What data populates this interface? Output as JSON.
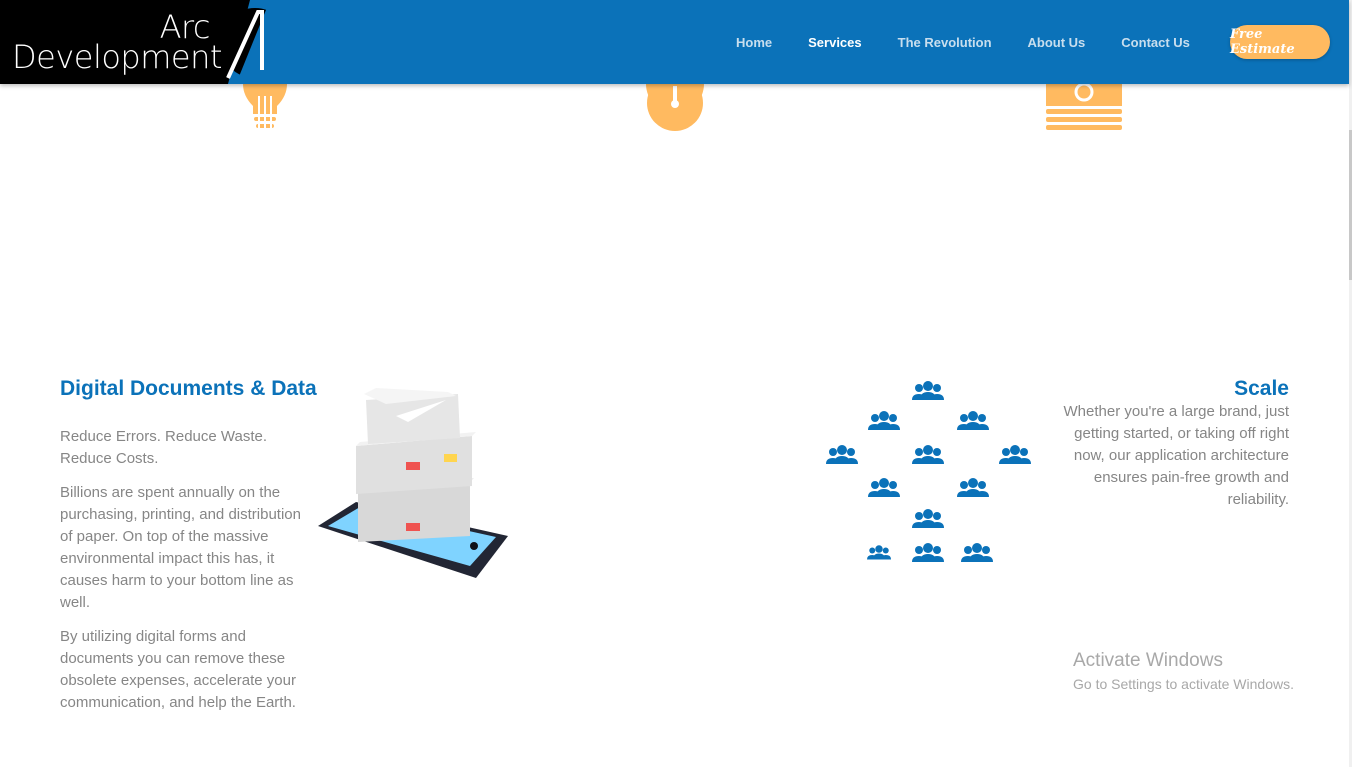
{
  "header": {
    "logo_line1": "Arc",
    "logo_line2": "Development",
    "tabs": [
      {
        "label": "Home"
      },
      {
        "label": "Services"
      },
      {
        "label": "The Revolution"
      },
      {
        "label": "About Us"
      },
      {
        "label": "Contact Us"
      }
    ],
    "active_tab": "Services",
    "estimate_label": "Free Estimate",
    "colors": {
      "primary": "#0b72b9",
      "accent": "#ffba60"
    }
  },
  "top_icons": [
    "lightbulb-icon",
    "stopwatch-icon",
    "cash-icon"
  ],
  "documents": {
    "title": "Digital Documents & Data",
    "subtitle": "Reduce Errors. Reduce Waste. Reduce Costs.",
    "paragraph1": "Billions are spent annually on the purchasing, printing, and distribution of paper. On top of the massive environmental impact this has, it causes harm to your bottom line as well.",
    "paragraph2": "By utilizing digital forms and documents you can remove these obsolete expenses, accelerate your communication, and help the Earth."
  },
  "scale": {
    "title": "Scale",
    "paragraph": "Whether you're a large brand, just getting started, or taking off right now, our application architecture ensures pain-free growth and reliability."
  },
  "watermark": {
    "title": "Activate Windows",
    "subtitle": "Go to Settings to activate Windows."
  }
}
